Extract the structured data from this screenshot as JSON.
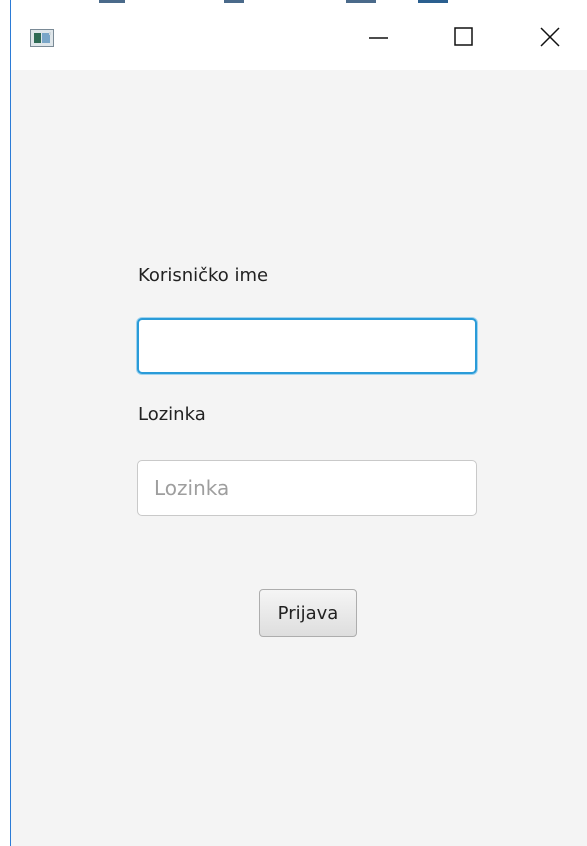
{
  "window": {
    "icon": "java-app-icon",
    "controls": {
      "minimize": "minimize-icon",
      "maximize": "maximize-icon",
      "close": "close-icon"
    }
  },
  "form": {
    "username_label": "Korisničko ime",
    "username_value": "",
    "username_placeholder": "",
    "password_label": "Lozinka",
    "password_value": "",
    "password_placeholder": "Lozinka",
    "login_button": "Prijava"
  },
  "colors": {
    "focus_border": "#2a9bd8",
    "window_background": "#f4f4f4",
    "window_border": "#2b7bd6"
  }
}
